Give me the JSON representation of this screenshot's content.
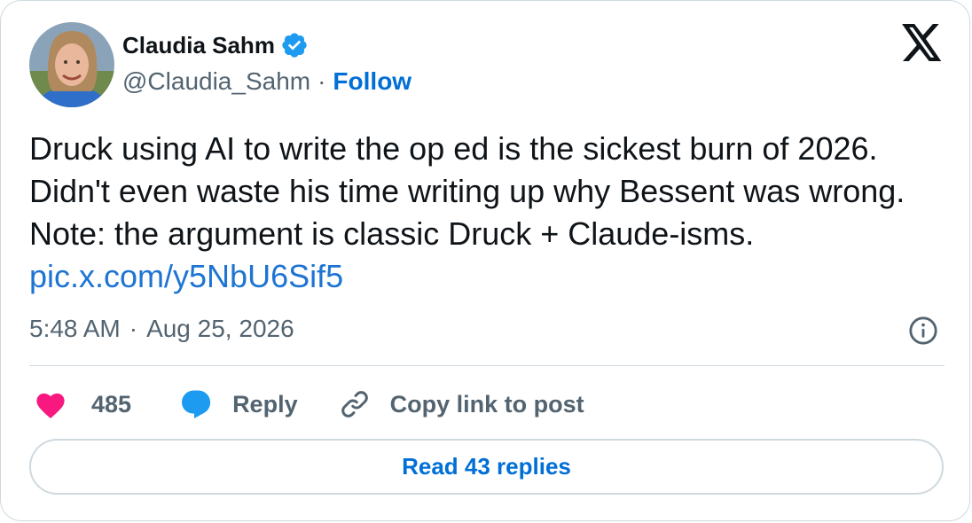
{
  "author": {
    "display_name": "Claudia Sahm",
    "handle": "@Claudia_Sahm",
    "separator": "·",
    "follow_label": "Follow"
  },
  "tweet": {
    "text": "Druck using AI to write the op ed is the sickest burn of 2026. Didn't even waste his time writing up why Bessent was wrong. Note: the argument is classic Druck + Claude-isms.",
    "link": "pic.x.com/y5NbU6Sif5",
    "time": "5:48 AM",
    "time_separator": "·",
    "date": "Aug 25, 2026"
  },
  "actions": {
    "like_count": "485",
    "reply_label": "Reply",
    "copy_link_label": "Copy link to post"
  },
  "read_replies_label": "Read 43 replies",
  "colors": {
    "accent": "#006fd6",
    "like": "#f91880",
    "reply_bubble": "#1d9bf0",
    "muted": "#536471",
    "border": "#cfd9de"
  },
  "icons": [
    "verified-badge-icon",
    "x-logo-icon",
    "info-icon",
    "heart-icon",
    "reply-bubble-icon",
    "link-chain-icon"
  ]
}
